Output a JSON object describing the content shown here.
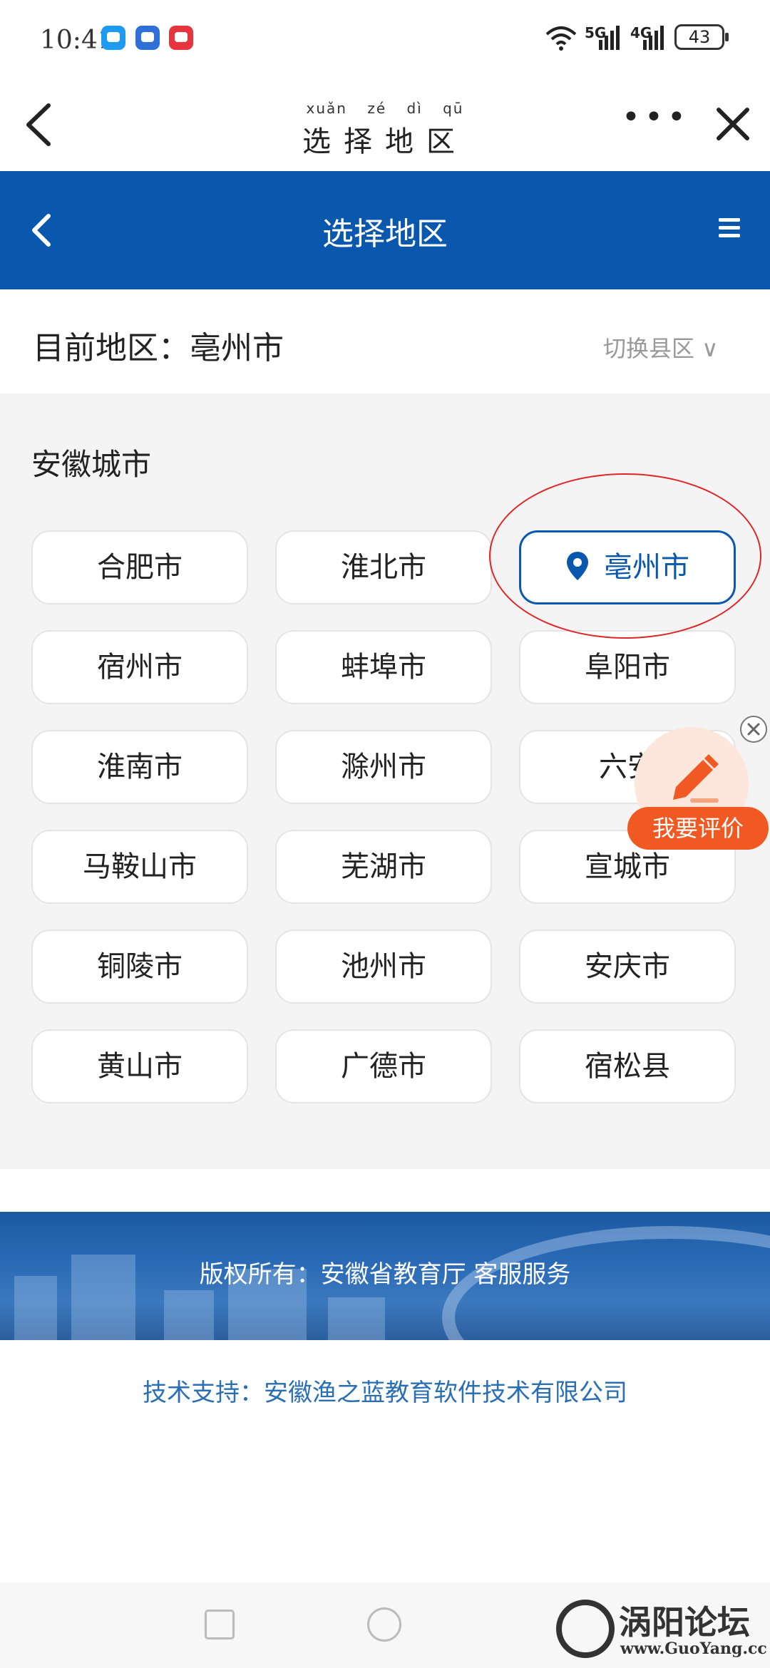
{
  "status_bar": {
    "time": "10:41",
    "signal_1": "5G",
    "signal_2": "4G",
    "battery": "43"
  },
  "top_nav": {
    "pinyin": "xuǎn zé dì qū",
    "title": "选择地区"
  },
  "header": {
    "title": "选择地区"
  },
  "current": {
    "label": "目前地区：亳州市",
    "switch_label": "切换县区 ∨"
  },
  "section": {
    "title": "安徽城市",
    "cities": [
      {
        "name": "合肥市"
      },
      {
        "name": "淮北市"
      },
      {
        "name": "亳州市",
        "active": true
      },
      {
        "name": "宿州市"
      },
      {
        "name": "蚌埠市"
      },
      {
        "name": "阜阳市"
      },
      {
        "name": "淮南市"
      },
      {
        "name": "滁州市"
      },
      {
        "name": "六安"
      },
      {
        "name": "马鞍山市"
      },
      {
        "name": "芜湖市"
      },
      {
        "name": "宣城市"
      },
      {
        "name": "铜陵市"
      },
      {
        "name": "池州市"
      },
      {
        "name": "安庆市"
      },
      {
        "name": "黄山市"
      },
      {
        "name": "广德市"
      },
      {
        "name": "宿松县"
      }
    ]
  },
  "feedback": {
    "label": "我要评价"
  },
  "footer": {
    "copyright": "版权所有：安徽省教育厅 客服服务",
    "tech": "技术支持：安徽渔之蓝教育软件技术有限公司"
  },
  "watermark": {
    "name": "涡阳论坛",
    "url": "www.GuoYang.cc"
  },
  "colors": {
    "primary": "#0a58ad",
    "accent": "#f05a22",
    "highlight": "#e02424"
  }
}
